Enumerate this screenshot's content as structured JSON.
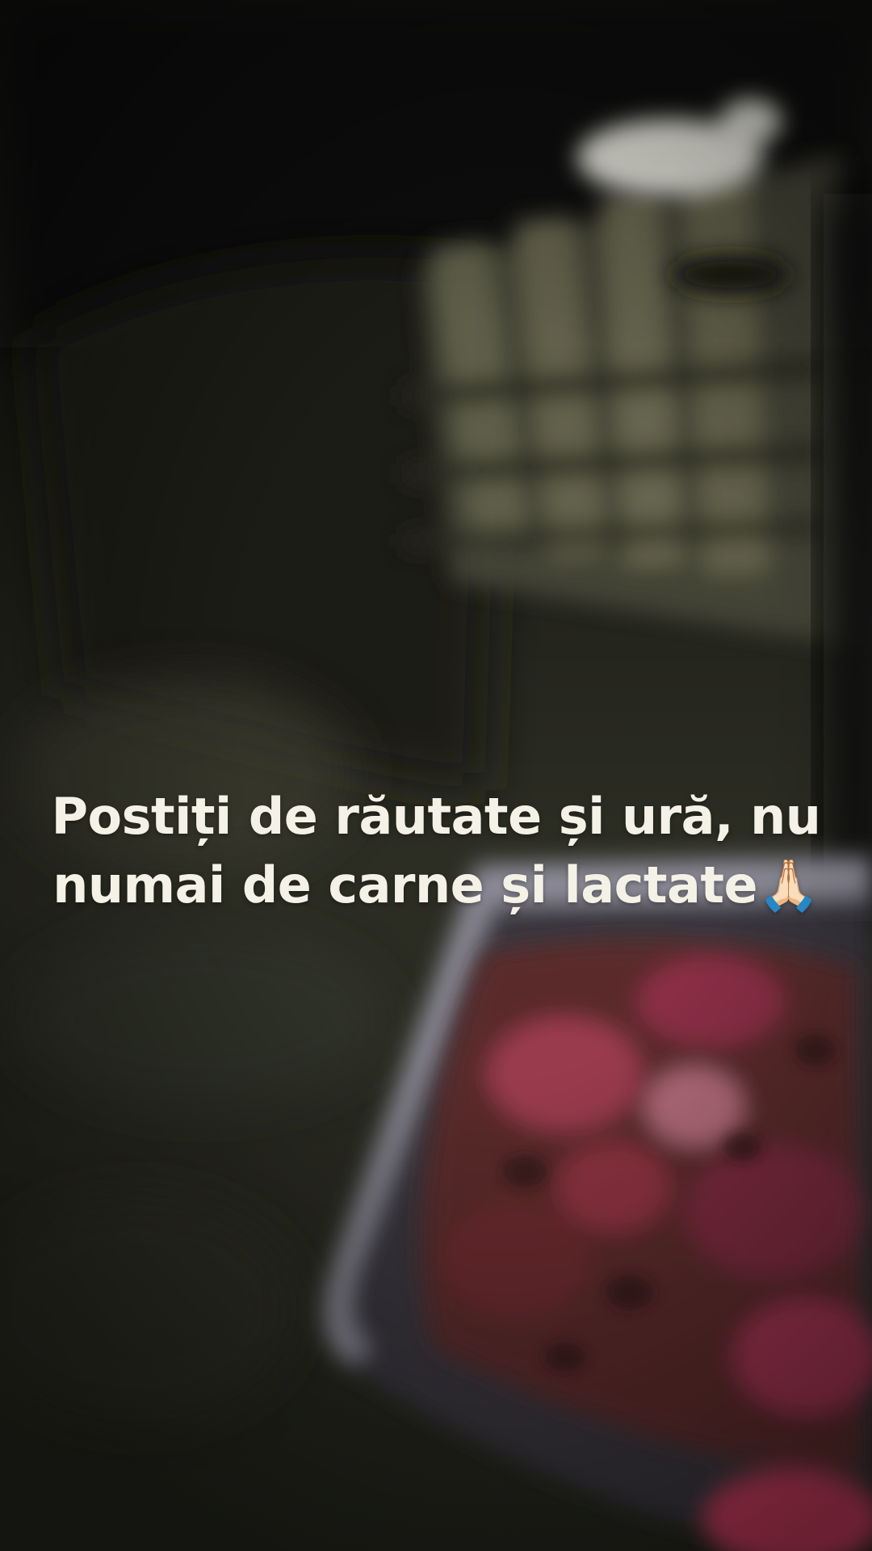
{
  "video": {
    "caption_lines": [
      "Postiți de răutate și ură, nu",
      "numai de carne și lactate🙏🏻"
    ]
  },
  "colors": {
    "caption_text": "#f4f1e6",
    "background_dark": "#0b0c0a",
    "ground": "#2b2c22",
    "meat": "#8a2c3e",
    "container": "#9b9aa8"
  }
}
